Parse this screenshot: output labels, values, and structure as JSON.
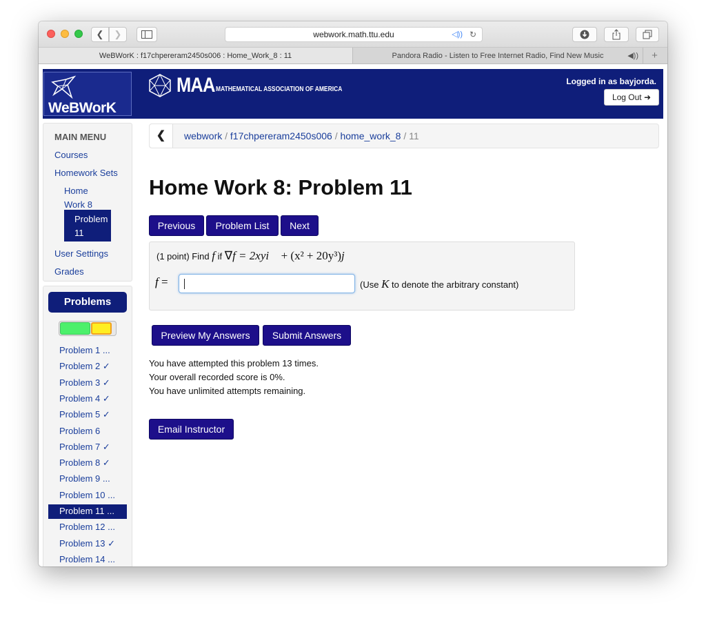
{
  "browser": {
    "url": "webwork.math.ttu.edu",
    "tabs": [
      {
        "title": "WeBWorK : f17chpereram2450s006 : Home_Work_8 : 11",
        "active": true
      },
      {
        "title": "Pandora Radio - Listen to Free Internet Radio, Find New Music",
        "active": false
      }
    ]
  },
  "header": {
    "webwork_logo": "WeBWorK",
    "maa_logo": "MAA",
    "maa_subtitle": "MATHEMATICAL ASSOCIATION OF AMERICA",
    "logged_in": "Logged in as bayjorda.",
    "logout_label": "Log Out"
  },
  "main_menu": {
    "title": "MAIN MENU",
    "courses": "Courses",
    "homework_sets": "Homework Sets",
    "home_work_8_line1": "Home",
    "home_work_8_line2": "Work 8",
    "problem_11_line1": "Problem",
    "problem_11_line2": "11",
    "user_settings": "User Settings",
    "grades": "Grades"
  },
  "problems_panel": {
    "button_label": "Problems",
    "items": [
      "Problem 1 ...",
      "Problem 2 ✓",
      "Problem 3 ✓",
      "Problem 4 ✓",
      "Problem 5 ✓",
      "Problem 6",
      "Problem 7 ✓",
      "Problem 8 ✓",
      "Problem 9 ...",
      "Problem 10 ...",
      "Problem 11 ...",
      "Problem 12 ...",
      "Problem 13 ✓",
      "Problem 14 ..."
    ],
    "active_index": 10
  },
  "breadcrumb": {
    "webwork": "webwork",
    "course": "f17chpereram2450s006",
    "set": "home_work_8",
    "problem": "11",
    "sep": "/"
  },
  "page_title": "Home Work 8: Problem 11",
  "nav_buttons": {
    "previous": "Previous",
    "problem_list": "Problem List",
    "next": "Next"
  },
  "problem": {
    "points": "(1 point) Find",
    "f": "f",
    "if": "if",
    "nabla": "∇",
    "eq1": "f = 2xy",
    "i_vec": "i⃗",
    "plus_term": " + (x² + 20y³)",
    "j_vec": "j⃗",
    "answer_label_f": "f",
    "answer_label_eq": " =",
    "answer_value": "",
    "note_pre": "(Use ",
    "note_k": "K",
    "note_post": " to denote the arbitrary constant)"
  },
  "answer_buttons": {
    "preview": "Preview My Answers",
    "submit": "Submit Answers"
  },
  "status": {
    "attempts": "You have attempted this problem 13 times.",
    "score": "Your overall recorded score is 0%.",
    "remaining": "You have unlimited attempts remaining."
  },
  "email_button": "Email Instructor",
  "colors": {
    "banner": "#0f1e7a",
    "button": "#1d0f8a",
    "link": "#1a3e9b",
    "progress_green": "#4cf06b",
    "progress_yellow": "#ffee22"
  }
}
